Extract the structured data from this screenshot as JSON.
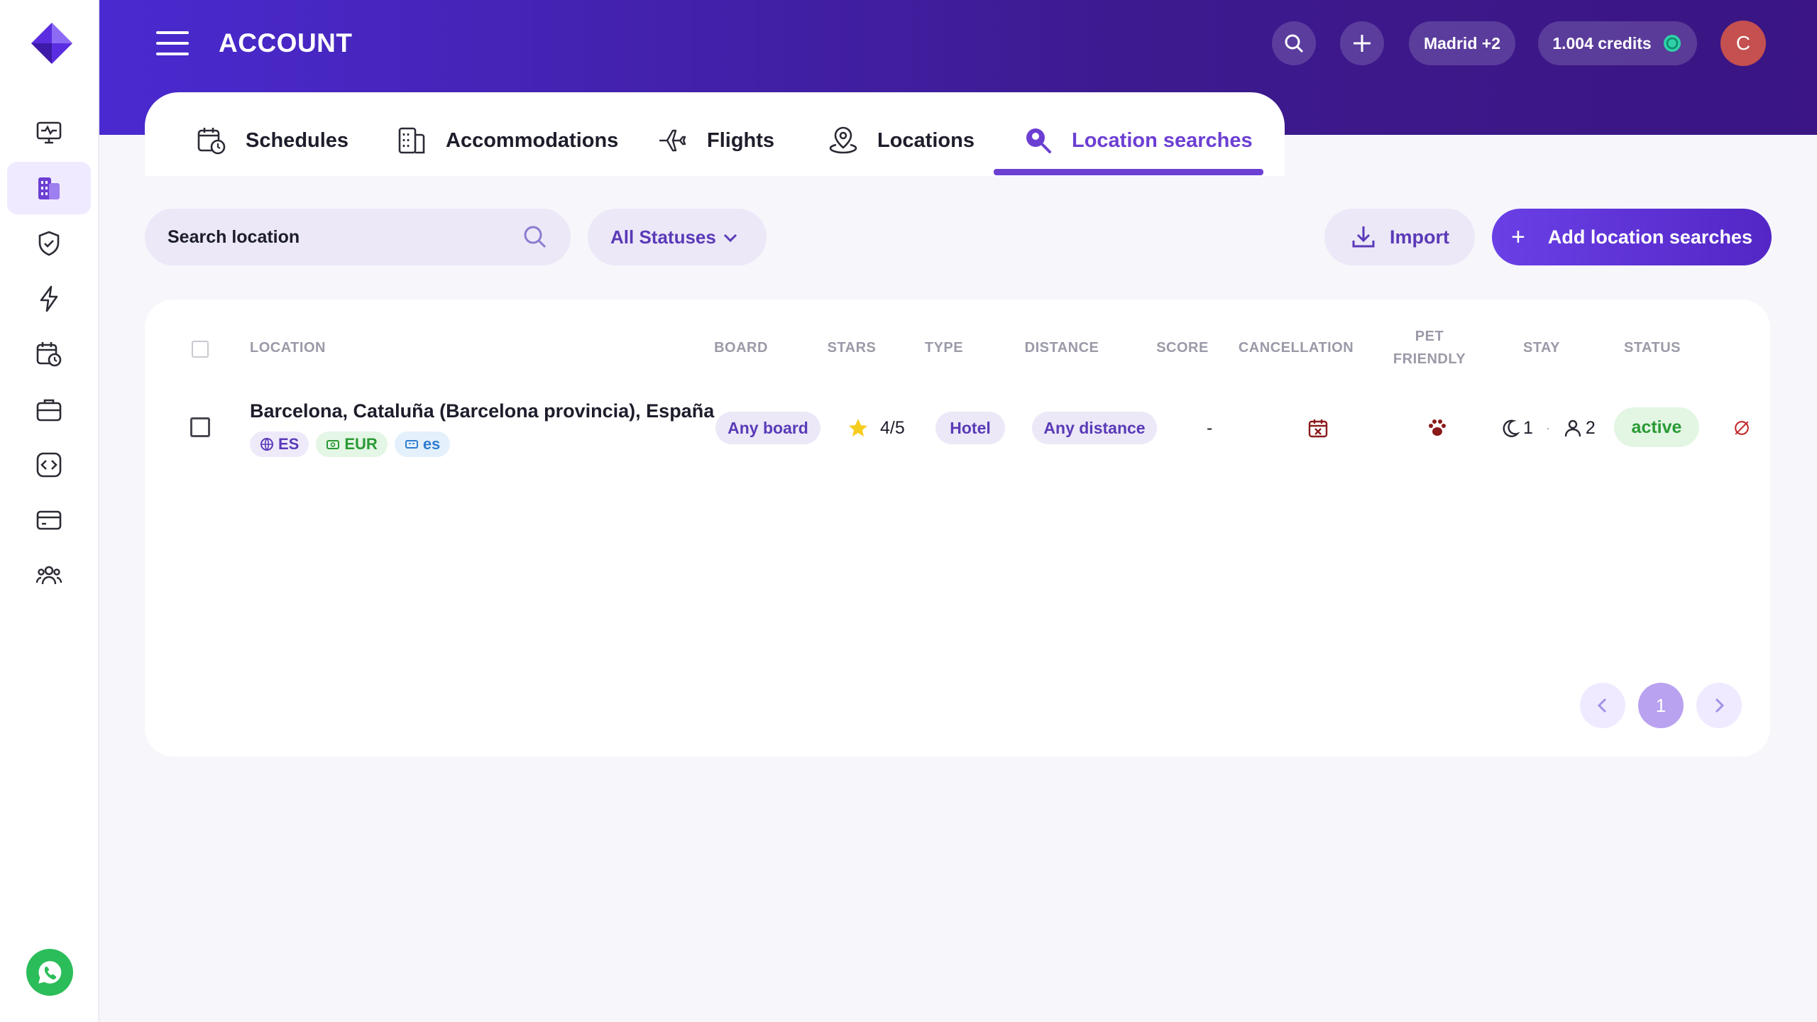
{
  "header": {
    "title": "ACCOUNT",
    "location_filter": "Madrid +2",
    "credits": "1.004 credits",
    "avatar_initial": "C"
  },
  "tabs": [
    {
      "label": "Schedules",
      "icon": "calendar-clock-icon"
    },
    {
      "label": "Accommodations",
      "icon": "building-icon"
    },
    {
      "label": "Flights",
      "icon": "plane-icon"
    },
    {
      "label": "Locations",
      "icon": "map-pin-icon"
    },
    {
      "label": "Location searches",
      "icon": "search-pin-icon",
      "active": true
    }
  ],
  "toolbar": {
    "search_placeholder": "Search location",
    "status_filter": "All Statuses",
    "import_label": "Import",
    "add_label": "Add location searches"
  },
  "table": {
    "columns": {
      "location": "LOCATION",
      "board": "BOARD",
      "stars": "STARS",
      "type": "TYPE",
      "distance": "DISTANCE",
      "score": "SCORE",
      "cancellation": "CANCELLATION",
      "pet_friendly": "PET FRIENDLY",
      "stay": "STAY",
      "status": "STATUS"
    },
    "rows": [
      {
        "location": "Barcelona, Cataluña (Barcelona provincia), España",
        "country": "ES",
        "currency": "EUR",
        "language": "es",
        "board": "Any board",
        "stars": "4/5",
        "type": "Hotel",
        "distance": "Any distance",
        "score": "-",
        "nights": "1",
        "guests": "2",
        "status": "active"
      }
    ]
  },
  "pagination": {
    "current_page": "1"
  },
  "colors": {
    "accent": "#6c3fd3",
    "header_start": "#4a2ad0",
    "header_end": "#3a1583",
    "status_active": "#2a9a34",
    "pet_icon": "#8b1a1a"
  }
}
